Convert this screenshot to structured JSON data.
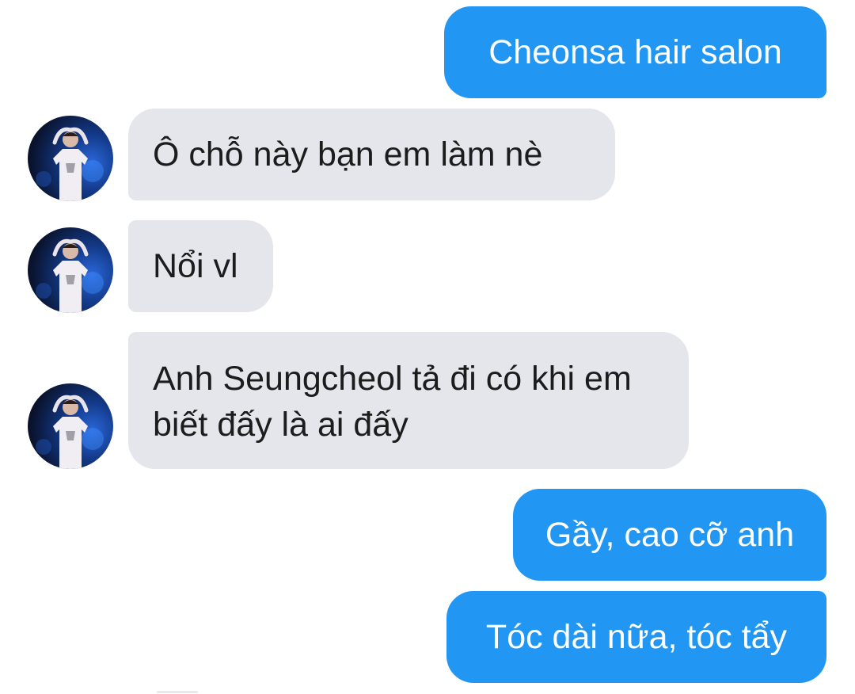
{
  "conversation": {
    "messages": [
      {
        "direction": "outgoing",
        "text": "Cheonsa hair salon"
      },
      {
        "direction": "incoming",
        "text": "Ô chỗ này bạn em làm nè"
      },
      {
        "direction": "incoming",
        "text": "Nổi vl"
      },
      {
        "direction": "incoming",
        "text": "Anh Seungcheol tả đi có khi em biết đấy là ai đấy"
      },
      {
        "direction": "outgoing",
        "text": "Gầy, cao cỡ anh"
      },
      {
        "direction": "outgoing",
        "text": "Tóc dài nữa, tóc tẩy"
      }
    ]
  },
  "colors": {
    "outgoing_bubble": "#2196f3",
    "incoming_bubble": "#e4e6eb",
    "incoming_text": "#1c1c1c",
    "outgoing_text": "#ffffff"
  },
  "icons": {
    "avatar": "contact-avatar-photo"
  }
}
